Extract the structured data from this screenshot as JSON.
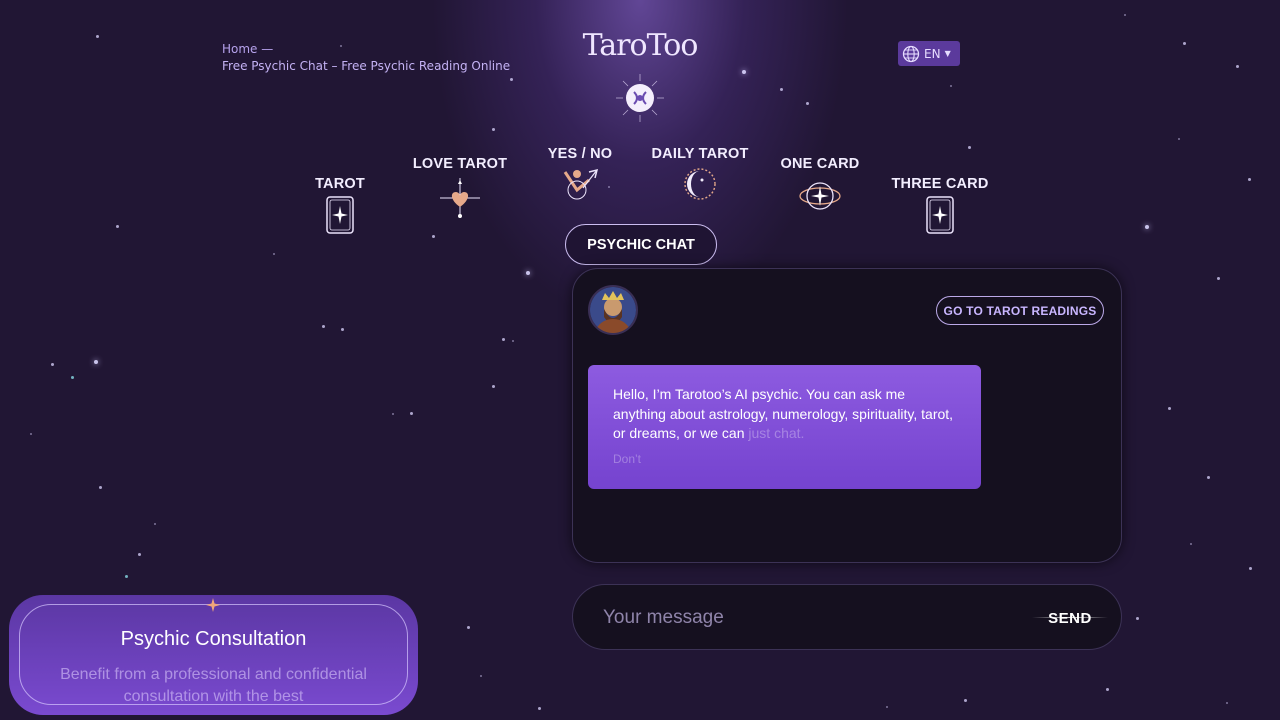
{
  "breadcrumb": {
    "home": "Home",
    "separator": "—",
    "current": "Free Psychic Chat – Free Psychic Reading Online"
  },
  "logo": {
    "text": "TaroToo"
  },
  "language": {
    "code": "EN"
  },
  "nav": {
    "tarot": "TAROT",
    "love_tarot": "LOVE TAROT",
    "yes_no": "YES / NO",
    "daily_tarot": "DAILY TAROT",
    "one_card": "ONE CARD",
    "three_card": "THREE CARD",
    "psychic_chat": "PSYCHIC CHAT"
  },
  "chat": {
    "goto_button": "GO TO TAROT READINGS",
    "message_visible": "Hello, I’m Tarotoo’s AI psychic. You can ask me anything about astrology, numerology, spirituality, tarot, or dreams, or we can",
    "message_faded": "just chat.",
    "message_faded_2": "Don’t",
    "input_placeholder": "Your message",
    "send_label": "SEND"
  },
  "consultation": {
    "title": "Psychic Consultation",
    "description": "Benefit from a professional and confidential consultation with the best"
  },
  "colors": {
    "background": "#211634",
    "accent": "#7a4ad0",
    "bubble": "#8d5be0",
    "link": "#b6a2ec"
  }
}
